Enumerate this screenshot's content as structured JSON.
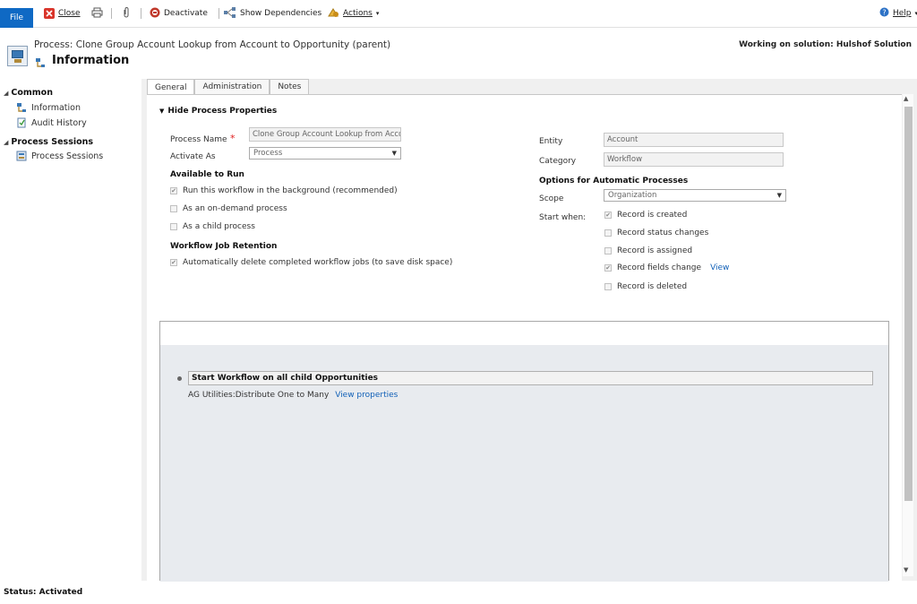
{
  "ribbon": {
    "file": "File",
    "close": "Close",
    "deactivate": "Deactivate",
    "show_dependencies": "Show Dependencies",
    "actions": "Actions",
    "help": "Help"
  },
  "header": {
    "subtitle": "Process: Clone Group Account Lookup from Account to Opportunity (parent)",
    "title": "Information",
    "solution": "Working on solution: Hulshof Solution"
  },
  "nav": {
    "common": "Common",
    "items": [
      "Information",
      "Audit History"
    ],
    "sessions_group": "Process Sessions",
    "sessions_item": "Process Sessions"
  },
  "tabs": [
    "General",
    "Administration",
    "Notes"
  ],
  "section_title": "Hide Process Properties",
  "form": {
    "process_name_label": "Process Name",
    "process_name_value": "Clone Group Account Lookup from Acco",
    "activate_as_label": "Activate As",
    "activate_as_value": "Process",
    "available_to_run": "Available to Run",
    "run_background": "Run this workflow in the background (recommended)",
    "on_demand": "As an on-demand process",
    "child_process": "As a child process",
    "job_retention": "Workflow Job Retention",
    "auto_delete": "Automatically delete completed workflow jobs (to save disk space)",
    "entity_label": "Entity",
    "entity_value": "Account",
    "category_label": "Category",
    "category_value": "Workflow",
    "options_title": "Options for Automatic Processes",
    "scope_label": "Scope",
    "scope_value": "Organization",
    "start_when_label": "Start when:",
    "record_created": "Record is created",
    "record_status": "Record status changes",
    "record_assigned": "Record is assigned",
    "record_fields": "Record fields change",
    "view": "View",
    "record_deleted": "Record is deleted"
  },
  "workflow": {
    "step_title": "Start Workflow on all child Opportunities",
    "step_desc": "AG Utilities:Distribute One to Many",
    "view_properties": "View properties"
  },
  "status": "Status: Activated",
  "colors": {
    "accent": "#0f69c4",
    "link": "#1160b7",
    "required": "#e02020"
  }
}
